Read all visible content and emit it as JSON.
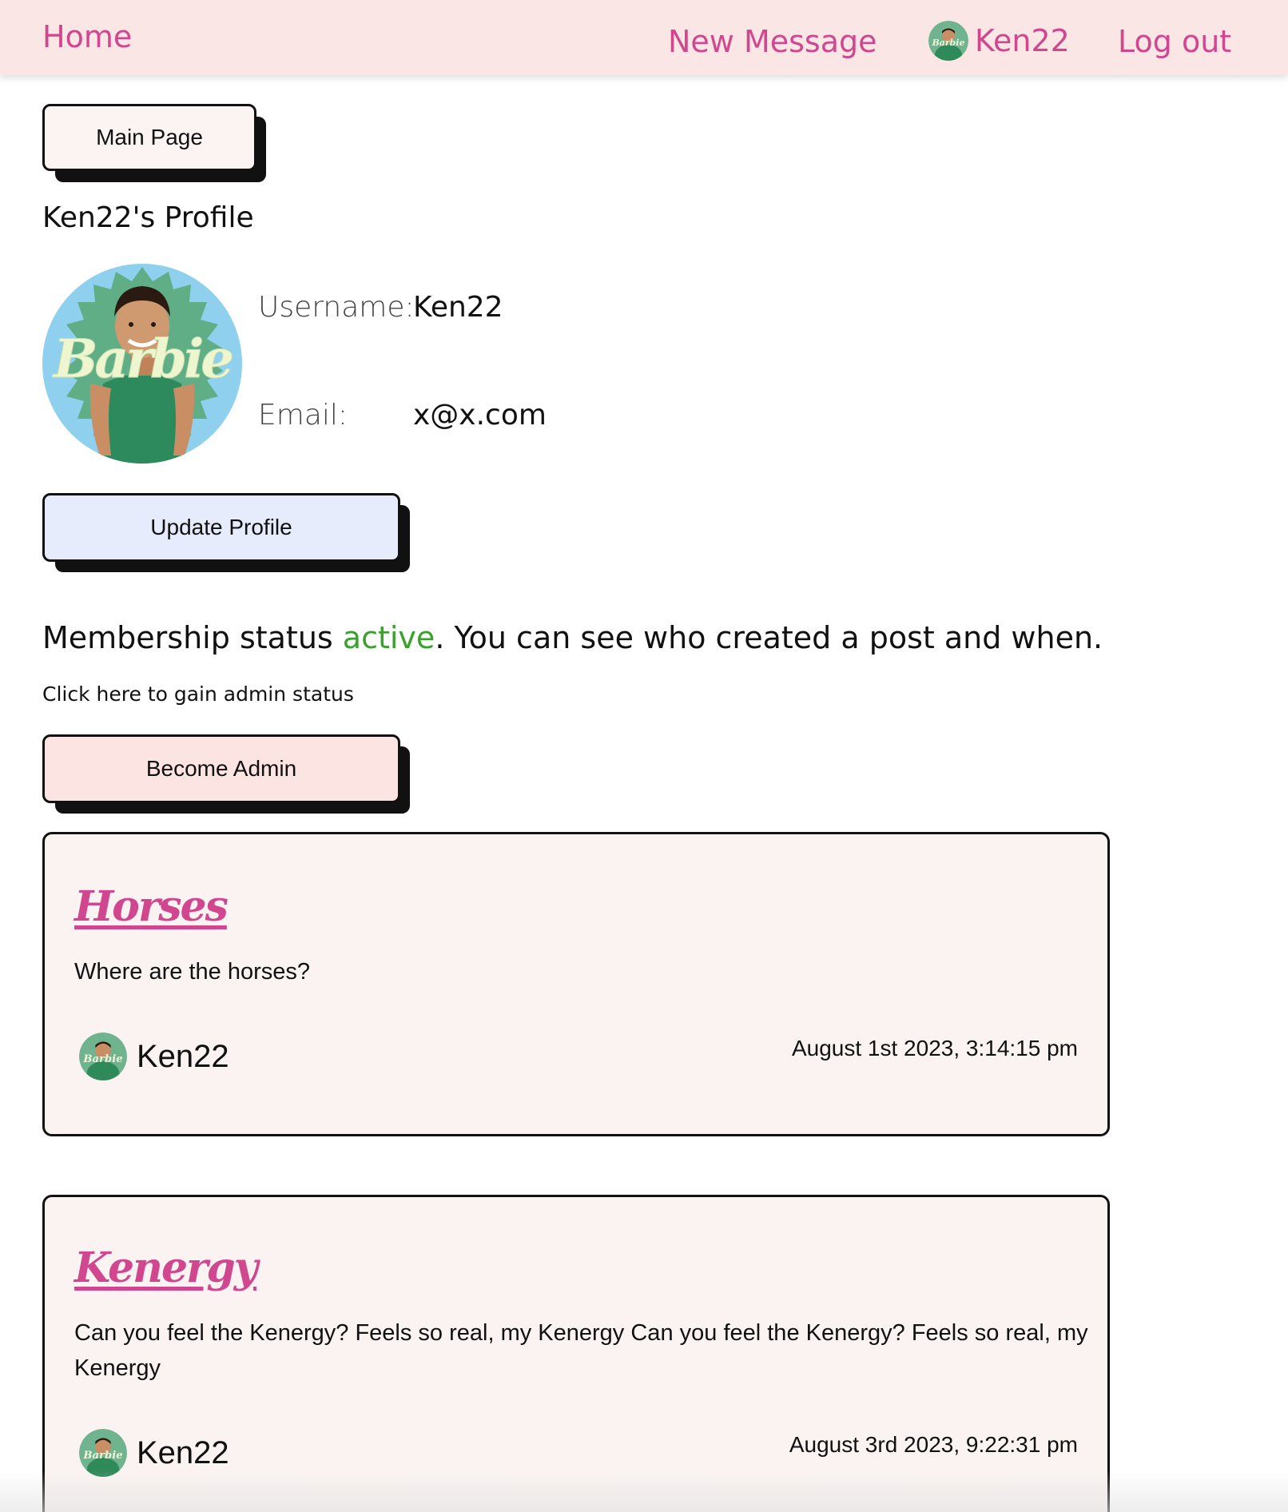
{
  "nav": {
    "home": "Home",
    "new_message": "New Message",
    "username": "Ken22",
    "logout": "Log out"
  },
  "buttons": {
    "main_page": "Main Page",
    "update_profile": "Update Profile",
    "become_admin": "Become Admin"
  },
  "profile": {
    "title": "Ken22's Profile",
    "username_label": "Username:",
    "username": "Ken22",
    "email_label": "Email:",
    "email": "x@x.com",
    "avatar_text": "Barbie"
  },
  "membership": {
    "prefix": "Membership status ",
    "status": "active",
    "suffix": ". You can see who created a post and when.",
    "admin_hint": "Click here to gain admin status"
  },
  "posts": [
    {
      "title": "Horses",
      "body": "Where are the horses?",
      "author": "Ken22",
      "date": "August 1st 2023, 3:14:15 pm"
    },
    {
      "title": "Kenergy",
      "body": "Can you feel the Kenergy? Feels so real, my Kenergy Can you feel the Kenergy? Feels so real, my Kenergy",
      "author": "Ken22",
      "date": "August 3rd 2023, 9:22:31 pm"
    }
  ],
  "colors": {
    "nav_bg": "#fbe6e6",
    "link_pink": "#d1478f",
    "active_green": "#3aa12c",
    "main_page_btn": "#fbf4f2",
    "update_btn": "#e6ecfb",
    "admin_btn": "#fbe4e2",
    "card_bg": "#faf3f1"
  }
}
